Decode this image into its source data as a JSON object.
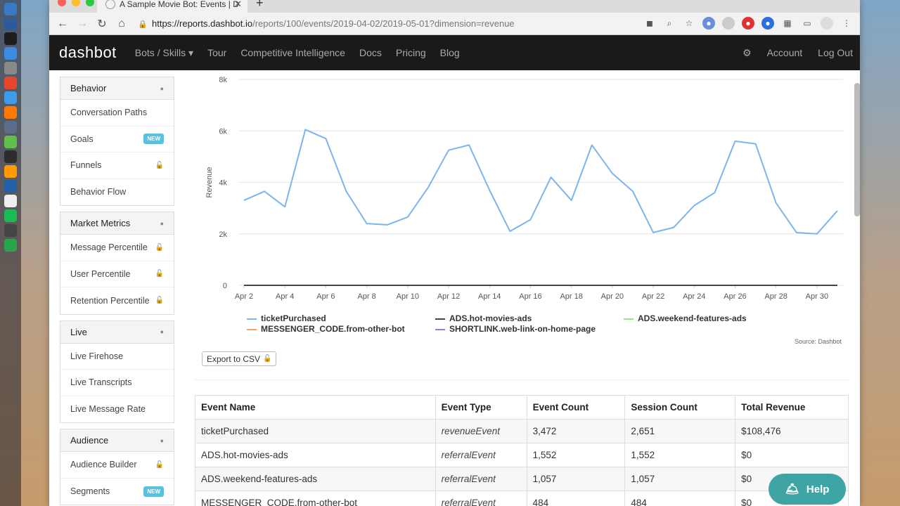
{
  "browser": {
    "tab_title": "A Sample Movie Bot: Events | D",
    "url_host": "https://reports.dashbot.io",
    "url_path": "/reports/100/events/2019-04-02/2019-05-01?dimension=revenue"
  },
  "appnav": {
    "logo": "dashbot",
    "links": [
      "Bots / Skills ▾",
      "Tour",
      "Competitive Intelligence",
      "Docs",
      "Pricing",
      "Blog"
    ],
    "account": "Account",
    "logout": "Log Out"
  },
  "sidebar": {
    "groups": [
      {
        "title": "Behavior",
        "items": [
          {
            "label": "Conversation Paths",
            "tag": ""
          },
          {
            "label": "Goals",
            "tag": "new"
          },
          {
            "label": "Funnels",
            "tag": "lock"
          },
          {
            "label": "Behavior Flow",
            "tag": ""
          }
        ]
      },
      {
        "title": "Market Metrics",
        "items": [
          {
            "label": "Message Percentile",
            "tag": "lock"
          },
          {
            "label": "User Percentile",
            "tag": "lock"
          },
          {
            "label": "Retention Percentile",
            "tag": "lock"
          }
        ]
      },
      {
        "title": "Live",
        "items": [
          {
            "label": "Live Firehose",
            "tag": ""
          },
          {
            "label": "Live Transcripts",
            "tag": ""
          },
          {
            "label": "Live Message Rate",
            "tag": ""
          }
        ]
      },
      {
        "title": "Audience",
        "items": [
          {
            "label": "Audience Builder",
            "tag": "lock"
          },
          {
            "label": "Segments",
            "tag": "new"
          }
        ]
      }
    ],
    "new_label": "NEW"
  },
  "chart_data": {
    "type": "line",
    "title": "",
    "xlabel": "",
    "ylabel": "Revenue",
    "ylim": [
      0,
      8000
    ],
    "yticks": [
      "0",
      "2k",
      "4k",
      "6k",
      "8k"
    ],
    "x": [
      "Apr 2",
      "Apr 3",
      "Apr 4",
      "Apr 5",
      "Apr 6",
      "Apr 7",
      "Apr 8",
      "Apr 9",
      "Apr 10",
      "Apr 11",
      "Apr 12",
      "Apr 13",
      "Apr 14",
      "Apr 15",
      "Apr 16",
      "Apr 17",
      "Apr 18",
      "Apr 19",
      "Apr 20",
      "Apr 21",
      "Apr 22",
      "Apr 23",
      "Apr 24",
      "Apr 25",
      "Apr 26",
      "Apr 27",
      "Apr 28",
      "Apr 29",
      "Apr 30",
      "May 1"
    ],
    "xticks": [
      "Apr 2",
      "Apr 4",
      "Apr 6",
      "Apr 8",
      "Apr 10",
      "Apr 12",
      "Apr 14",
      "Apr 16",
      "Apr 18",
      "Apr 20",
      "Apr 22",
      "Apr 24",
      "Apr 26",
      "Apr 28",
      "Apr 30"
    ],
    "series": [
      {
        "name": "ticketPurchased",
        "color": "#7cb5ec",
        "values": [
          3300,
          3650,
          3050,
          6050,
          5700,
          3650,
          2400,
          2350,
          2650,
          3800,
          5250,
          5450,
          3700,
          2100,
          2550,
          4200,
          3300,
          5450,
          4350,
          3650,
          2050,
          2250,
          3100,
          3600,
          5600,
          5500,
          3200,
          2050,
          2000,
          2900
        ]
      },
      {
        "name": "ADS.hot-movies-ads",
        "color": "#434348",
        "values": [
          0,
          0,
          0,
          0,
          0,
          0,
          0,
          0,
          0,
          0,
          0,
          0,
          0,
          0,
          0,
          0,
          0,
          0,
          0,
          0,
          0,
          0,
          0,
          0,
          0,
          0,
          0,
          0,
          0,
          0
        ]
      },
      {
        "name": "ADS.weekend-features-ads",
        "color": "#90ed7d",
        "values": [
          0,
          0,
          0,
          0,
          0,
          0,
          0,
          0,
          0,
          0,
          0,
          0,
          0,
          0,
          0,
          0,
          0,
          0,
          0,
          0,
          0,
          0,
          0,
          0,
          0,
          0,
          0,
          0,
          0,
          0
        ]
      },
      {
        "name": "MESSENGER_CODE.from-other-bot",
        "color": "#f7a35c",
        "values": [
          0,
          0,
          0,
          0,
          0,
          0,
          0,
          0,
          0,
          0,
          0,
          0,
          0,
          0,
          0,
          0,
          0,
          0,
          0,
          0,
          0,
          0,
          0,
          0,
          0,
          0,
          0,
          0,
          0,
          0
        ]
      },
      {
        "name": "SHORTLINK.web-link-on-home-page",
        "color": "#8085e9",
        "values": [
          0,
          0,
          0,
          0,
          0,
          0,
          0,
          0,
          0,
          0,
          0,
          0,
          0,
          0,
          0,
          0,
          0,
          0,
          0,
          0,
          0,
          0,
          0,
          0,
          0,
          0,
          0,
          0,
          0,
          0
        ]
      }
    ],
    "grid": true,
    "legend": "bottom",
    "source": "Source: Dashbot"
  },
  "export_label": "Export to CSV",
  "table": {
    "headers": [
      "Event Name",
      "Event Type",
      "Event Count",
      "Session Count",
      "Total Revenue"
    ],
    "rows": [
      [
        "ticketPurchased",
        "revenueEvent",
        "3,472",
        "2,651",
        "$108,476"
      ],
      [
        "ADS.hot-movies-ads",
        "referralEvent",
        "1,552",
        "1,552",
        "$0"
      ],
      [
        "ADS.weekend-features-ads",
        "referralEvent",
        "1,057",
        "1,057",
        "$0"
      ],
      [
        "MESSENGER_CODE.from-other-bot",
        "referralEvent",
        "484",
        "484",
        "$0"
      ]
    ]
  },
  "help_label": "Help"
}
